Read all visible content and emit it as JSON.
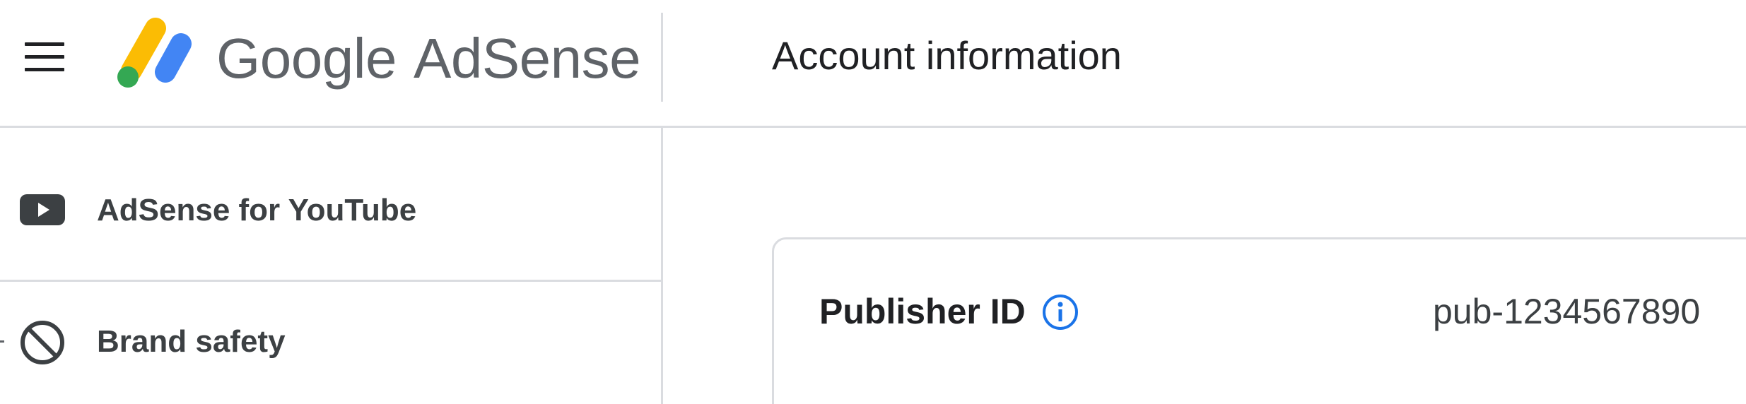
{
  "header": {
    "brand_google": "Google",
    "brand_product": "AdSense",
    "page_title": "Account information"
  },
  "sidebar": {
    "items": [
      {
        "label": "AdSense for YouTube",
        "icon": "youtube-icon"
      },
      {
        "label": "Brand safety",
        "icon": "block-icon"
      }
    ]
  },
  "account": {
    "publisher_id_label": "Publisher ID",
    "publisher_id_value": "pub-1234567890"
  },
  "colors": {
    "logo_yellow": "#FBBC04",
    "logo_blue": "#4285F4",
    "logo_green": "#34A853",
    "info_blue": "#1a73e8",
    "text_dark": "#202124",
    "text_grey": "#5f6368",
    "divider": "#dadce0"
  }
}
